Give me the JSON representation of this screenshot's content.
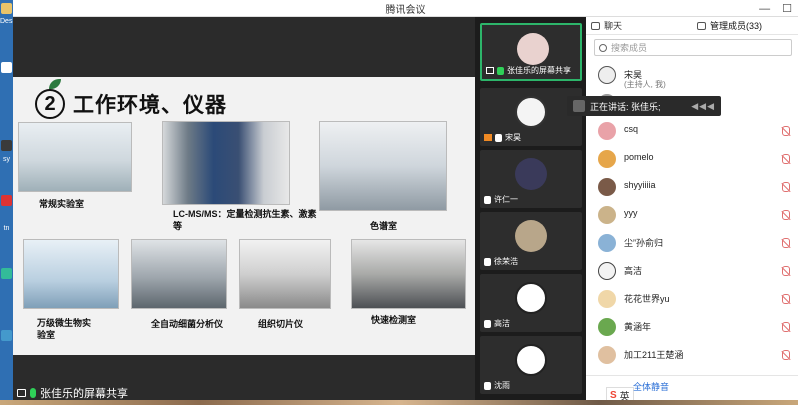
{
  "window": {
    "title": "腾讯会议"
  },
  "slide": {
    "number": "2",
    "heading": "工作环境、仪器",
    "photos": [
      {
        "caption": "常规实验室"
      },
      {
        "caption": "LC-MS/MS：定量检测抗生素、激素等"
      },
      {
        "caption": "色谱室"
      },
      {
        "caption": "万级微生物实验室"
      },
      {
        "caption": "全自动细菌分析仪"
      },
      {
        "caption": "组织切片仪"
      },
      {
        "caption": "快速检测室"
      }
    ]
  },
  "share_banner": "张佳乐的屏幕共享",
  "tiles": [
    {
      "name": "张佳乐的屏幕共享"
    },
    {
      "name": "宋昊"
    },
    {
      "name": "许仁一"
    },
    {
      "name": "徐荣浩"
    },
    {
      "name": "高洁"
    },
    {
      "name": "沈雨"
    }
  ],
  "panel": {
    "tab_chat": "聊天",
    "tab_members": "管理成员(33)",
    "search_placeholder": "搜索成员",
    "members": [
      {
        "name": "宋昊",
        "sub": "(主持人, 我)"
      },
      {
        "name": "",
        "sub": ""
      },
      {
        "name": "csq",
        "sub": ""
      },
      {
        "name": "pomelo",
        "sub": ""
      },
      {
        "name": "shyyiiiia",
        "sub": ""
      },
      {
        "name": "yyy",
        "sub": ""
      },
      {
        "name": "尘”孙俞归",
        "sub": ""
      },
      {
        "name": "高洁",
        "sub": ""
      },
      {
        "name": "花花世界yu",
        "sub": ""
      },
      {
        "name": "黄涵年",
        "sub": ""
      },
      {
        "name": "加工211王楚涵",
        "sub": ""
      }
    ],
    "mute_all": "全体静音"
  },
  "speaking": "正在讲话: 张佳乐;",
  "ime": {
    "label": "英"
  },
  "desk_labels": [
    "Desk",
    "sy",
    "tn"
  ],
  "colors": {
    "accent": "#2db56a",
    "link": "#2b6fd6"
  }
}
